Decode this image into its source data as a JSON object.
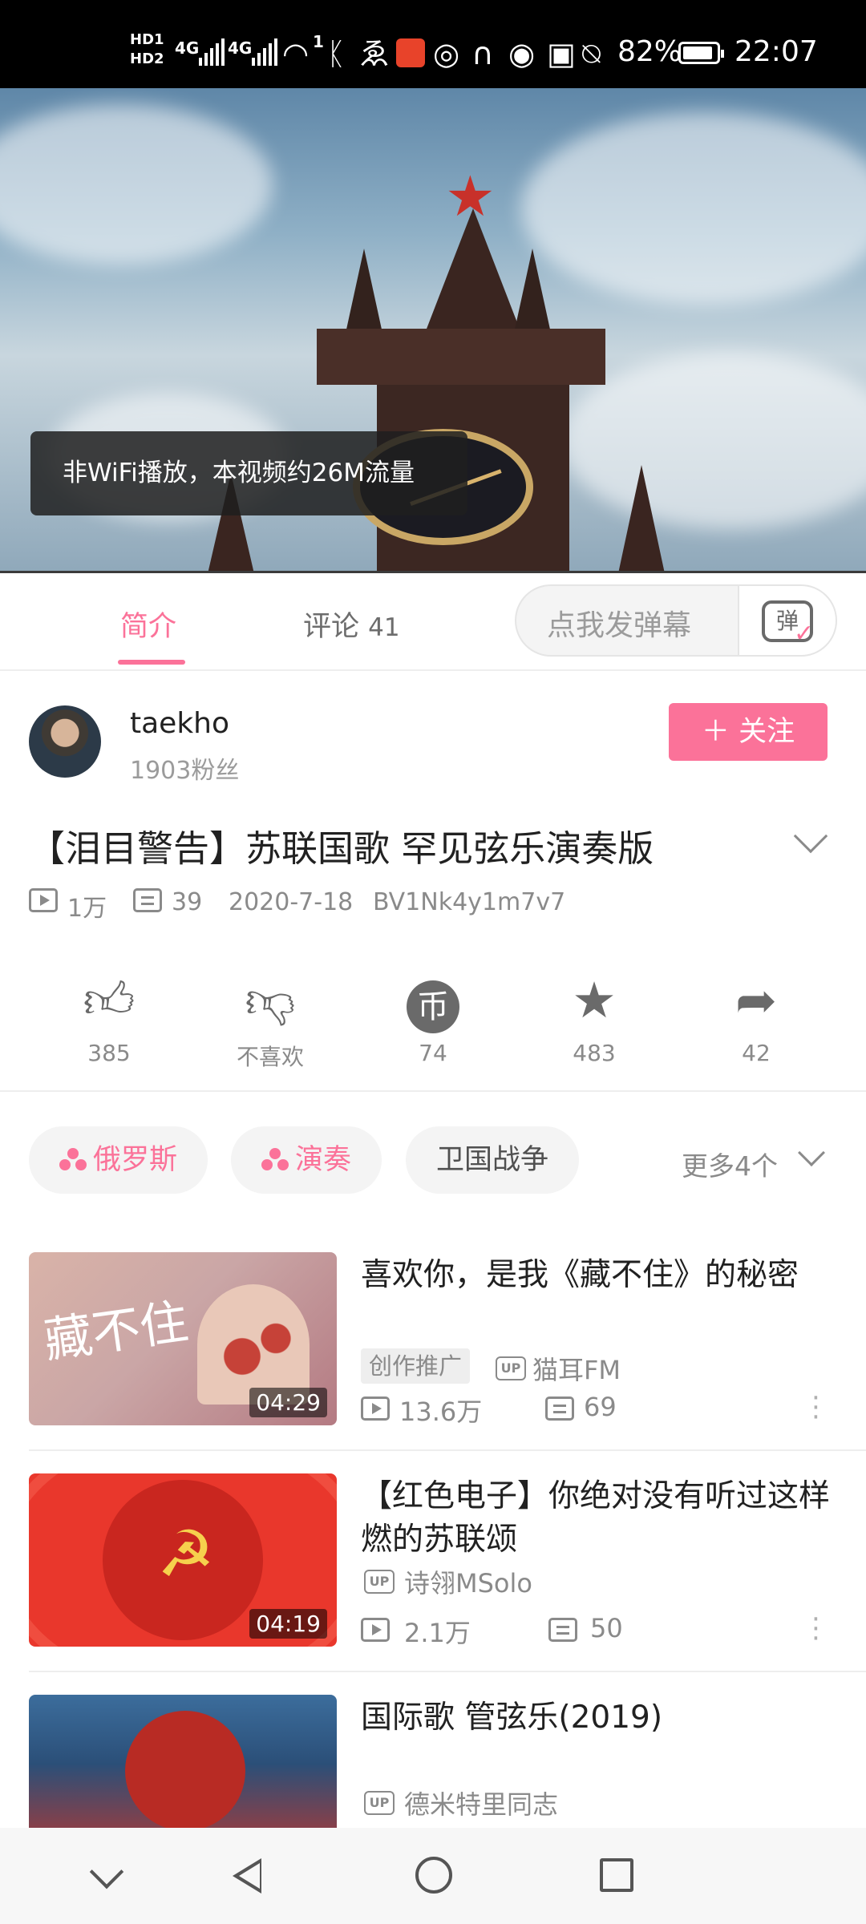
{
  "status_bar": {
    "hd1": "HD1",
    "hd2": "HD2",
    "net1": "4G",
    "net2": "4G",
    "wifi_sub": "1",
    "app_badge_icon": "app-badge-icon",
    "battery_percent": "82%",
    "time": "22:07"
  },
  "video": {
    "toast": "非WiFi播放，本视频约26M流量"
  },
  "tabs": {
    "intro": "简介",
    "comments": "评论",
    "comments_count": "41",
    "danmaku_placeholder": "点我发弹幕",
    "danmaku_icon_text": "弹"
  },
  "uploader": {
    "name": "taekho",
    "fans": "1903粉丝",
    "follow_label": "关注",
    "follow_plus": "＋"
  },
  "video_info": {
    "title": "【泪目警告】苏联国歌 罕见弦乐演奏版",
    "views": "1万",
    "danmaku_count": "39",
    "date": "2020-7-18",
    "bvid": "BV1Nk4y1m7v7"
  },
  "actions": {
    "like": "385",
    "dislike": "不喜欢",
    "coin": "74",
    "coin_glyph": "币",
    "favorite": "483",
    "share": "42"
  },
  "tags": {
    "items": [
      "俄罗斯",
      "演奏",
      "卫国战争"
    ],
    "more": "更多4个"
  },
  "related": [
    {
      "title": "喜欢你，是我《藏不住》的秘密",
      "duration": "04:29",
      "badge": "创作推广",
      "up_label": "UP",
      "uploader": "猫耳FM",
      "views": "13.6万",
      "danmaku": "69",
      "thumb_text": "藏不住"
    },
    {
      "title": "【红色电子】你绝对没有听过这样燃的苏联颂",
      "duration": "04:19",
      "up_label": "UP",
      "uploader": "诗翎MSolo",
      "views": "2.1万",
      "danmaku": "50",
      "thumb_text": "☭"
    },
    {
      "title": "国际歌 管弦乐(2019)",
      "up_label": "UP",
      "uploader": "德米特里同志"
    }
  ],
  "colors": {
    "accent": "#fb7299",
    "text": "#212121",
    "muted": "#8a8a8a"
  }
}
